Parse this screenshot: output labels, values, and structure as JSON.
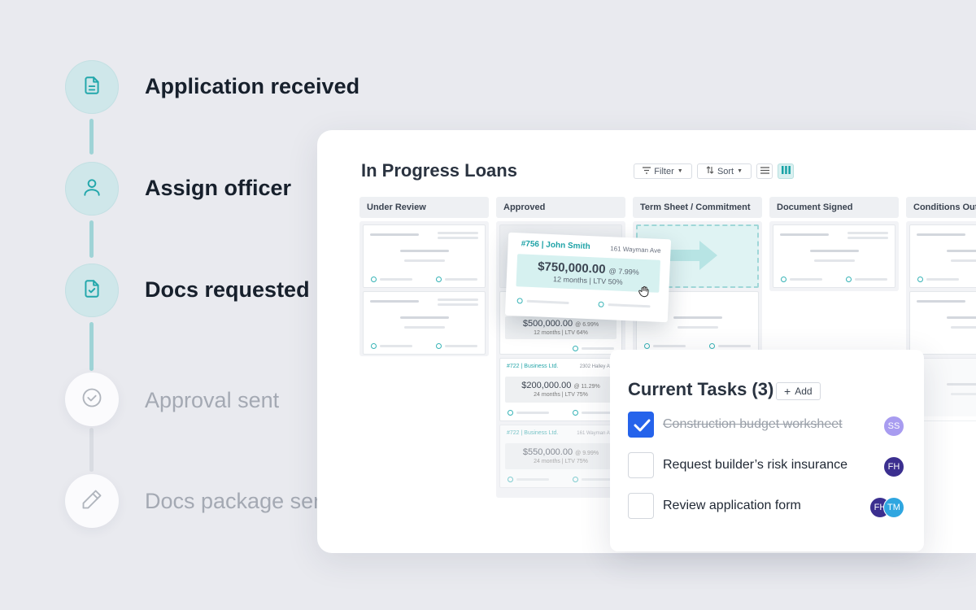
{
  "timeline": {
    "steps": [
      {
        "label": "Application received",
        "icon": "document-icon",
        "state": "done"
      },
      {
        "label": "Assign officer",
        "icon": "user-icon",
        "state": "done"
      },
      {
        "label": "Docs requested",
        "icon": "document-check-icon",
        "state": "done"
      },
      {
        "label": "Approval sent",
        "icon": "check-circle-icon",
        "state": "pending"
      },
      {
        "label": "Docs package sent",
        "icon": "pencil-icon",
        "state": "pending"
      }
    ]
  },
  "board": {
    "title": "In Progress Loans",
    "toolbar": {
      "filter_label": "Filter",
      "sort_label": "Sort"
    },
    "columns": [
      {
        "label": "Under Review"
      },
      {
        "label": "Approved"
      },
      {
        "label": "Term Sheet / Commitment"
      },
      {
        "label": "Document Signed"
      },
      {
        "label": "Conditions Outstanding"
      }
    ],
    "approved_cards": [
      {
        "id": "#722 | Business Ltd.",
        "address": "2302 Halley Ave",
        "amount": "$200,000.00",
        "rate": "@ 11.29%",
        "terms": "24 months  |  LTV 75%"
      },
      {
        "id": "#722 | Business Ltd.",
        "address": "161 Wayman Ave",
        "amount": "$550,000.00",
        "rate": "@ 9.99%",
        "terms": "24 months  |  LTV 75%"
      }
    ],
    "partial_card": {
      "amount": "$500,000.00",
      "rate": "@ 6.99%",
      "terms": "12 months  |  LTV 64%"
    },
    "dragged_card": {
      "id": "#756 | John Smith",
      "address": "161 Wayman Ave",
      "amount": "$750,000.00",
      "rate": "@ 7.99%",
      "terms": "12 months  |  LTV 50%"
    }
  },
  "tasks": {
    "title": "Current Tasks (3)",
    "add_label": "Add",
    "items": [
      {
        "text": "Construction budget worksheet",
        "done": true,
        "avatars": [
          {
            "initials": "SS",
            "color": "#a89cf0"
          }
        ]
      },
      {
        "text": "Request builder’s risk insurance",
        "done": false,
        "avatars": [
          {
            "initials": "FH",
            "color": "#3b2f8f"
          }
        ]
      },
      {
        "text": "Review application form",
        "done": false,
        "avatars": [
          {
            "initials": "FH",
            "color": "#3b2f8f"
          },
          {
            "initials": "TM",
            "color": "#2fa6e0"
          }
        ]
      }
    ]
  },
  "colors": {
    "accent": "#20a4a8",
    "checkbox_checked": "#2563eb"
  }
}
